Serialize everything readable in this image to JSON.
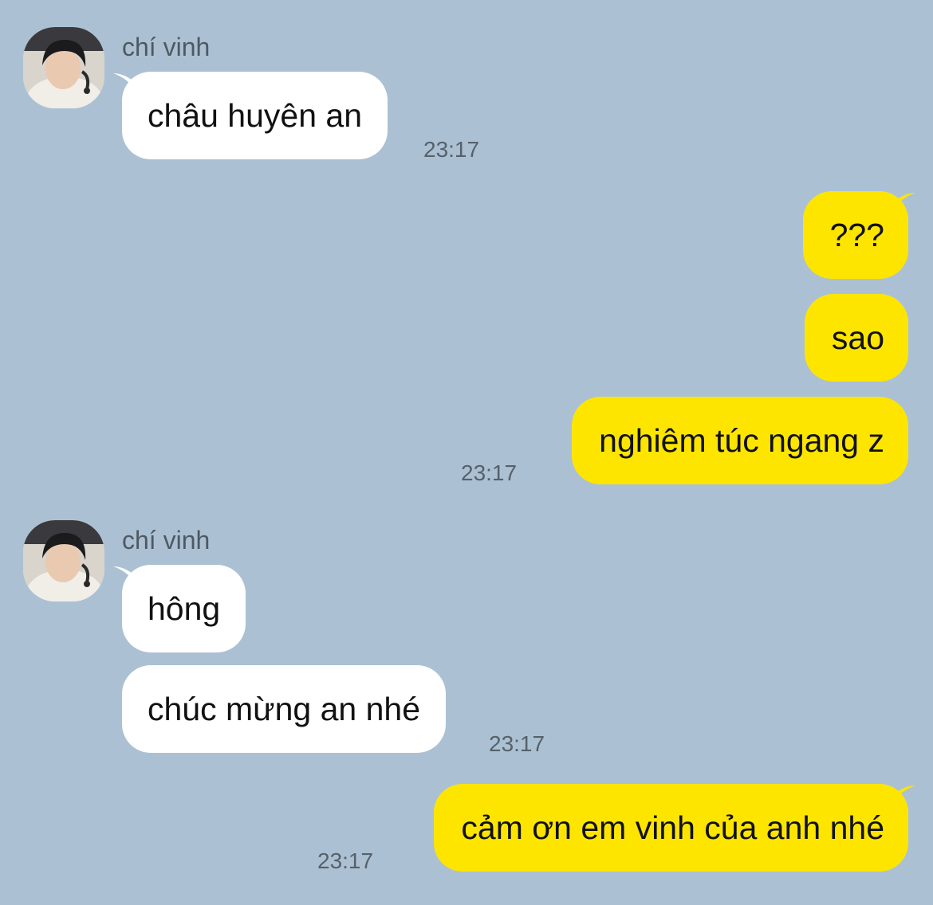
{
  "colors": {
    "background": "#abc1d3",
    "incoming_bubble": "#ffffff",
    "outgoing_bubble": "#fee500"
  },
  "groups": [
    {
      "sender": "chí vinh",
      "messages": [
        {
          "text": "châu huyên an",
          "time": "23:17"
        }
      ]
    },
    {
      "sender": "",
      "messages": [
        {
          "text": "???"
        },
        {
          "text": "sao"
        },
        {
          "text": "nghiêm túc ngang z",
          "time": "23:17"
        }
      ]
    },
    {
      "sender": "chí vinh",
      "messages": [
        {
          "text": "hông"
        },
        {
          "text": "chúc mừng an nhé",
          "time": "23:17"
        }
      ]
    },
    {
      "sender": "",
      "messages": [
        {
          "text": "cảm ơn em vinh của anh nhé",
          "time": "23:17"
        }
      ]
    }
  ]
}
